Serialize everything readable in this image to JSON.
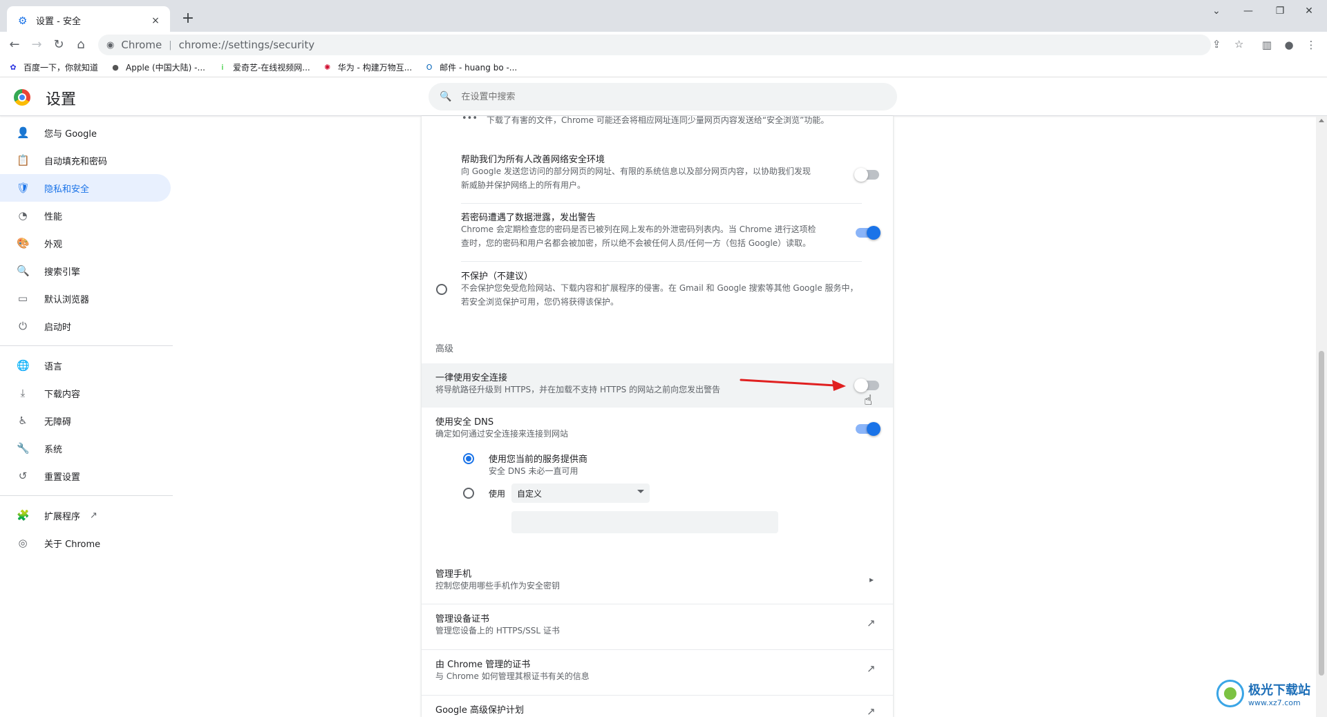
{
  "tab": {
    "title": "设置 - 安全",
    "favicon": "gear-icon",
    "close": "×"
  },
  "new_tab": "+",
  "window": {
    "minimize": "—",
    "restore": "❐",
    "close": "✕",
    "dropdown": "⌄"
  },
  "toolbar": {
    "site_name": "Chrome",
    "url": "chrome://settings/security"
  },
  "bookmarks": [
    {
      "label": "百度一下，你就知道",
      "icon": "baidu-icon",
      "color": "#2932e1",
      "glyph": "✿"
    },
    {
      "label": "Apple (中国大陆) -...",
      "icon": "apple-icon",
      "color": "#555555",
      "glyph": "●"
    },
    {
      "label": "爱奇艺-在线视频网...",
      "icon": "iqiyi-icon",
      "color": "#00be06",
      "glyph": "i"
    },
    {
      "label": "华为 - 构建万物互...",
      "icon": "huawei-icon",
      "color": "#cf0a2c",
      "glyph": "✺"
    },
    {
      "label": "邮件 - huang bo -...",
      "icon": "outlook-icon",
      "color": "#0364b8",
      "glyph": "O"
    }
  ],
  "header": {
    "title": "设置",
    "search_placeholder": "在设置中搜索"
  },
  "sidebar": {
    "items": [
      {
        "label": "您与 Google",
        "icon": "person-icon",
        "glyph": "👤"
      },
      {
        "label": "自动填充和密码",
        "icon": "clipboard-icon",
        "glyph": "📋"
      },
      {
        "label": "隐私和安全",
        "icon": "shield-icon",
        "glyph": "🛡"
      },
      {
        "label": "性能",
        "icon": "speedometer-icon",
        "glyph": "◔"
      },
      {
        "label": "外观",
        "icon": "palette-icon",
        "glyph": "🎨"
      },
      {
        "label": "搜索引擎",
        "icon": "search-icon",
        "glyph": "🔍"
      },
      {
        "label": "默认浏览器",
        "icon": "browser-icon",
        "glyph": "▭"
      },
      {
        "label": "启动时",
        "icon": "power-icon",
        "glyph": "⏻"
      },
      {
        "label": "语言",
        "icon": "globe-icon",
        "glyph": "🌐"
      },
      {
        "label": "下载内容",
        "icon": "download-icon",
        "glyph": "⤓"
      },
      {
        "label": "无障碍",
        "icon": "accessibility-icon",
        "glyph": "♿"
      },
      {
        "label": "系统",
        "icon": "wrench-icon",
        "glyph": "🔧"
      },
      {
        "label": "重置设置",
        "icon": "history-icon",
        "glyph": "↺"
      },
      {
        "label": "扩展程序",
        "icon": "puzzle-icon",
        "glyph": "🧩"
      },
      {
        "label": "关于 Chrome",
        "icon": "chrome-icon",
        "glyph": "◎"
      }
    ],
    "external_link_glyph": "↗"
  },
  "main": {
    "top_desc": "下载了有害的文件，Chrome 可能还会将相应网址连同少量网页内容发送给“安全浏览”功能。",
    "improve": {
      "title": "帮助我们为所有人改善网络安全环境",
      "desc1": "向 Google 发送您访问的部分网页的网址、有限的系统信息以及部分网页内容，以协助我们发现",
      "desc2": "新威胁并保护网络上的所有用户。",
      "enabled": false
    },
    "password_leak": {
      "title": "若密码遭遇了数据泄露，发出警告",
      "desc1": "Chrome 会定期检查您的密码是否已被列在网上发布的外泄密码列表内。当 Chrome 进行这项检",
      "desc2": "查时，您的密码和用户名都会被加密，所以绝不会被任何人员/任何一方（包括 Google）读取。",
      "enabled": true
    },
    "no_protection": {
      "title": "不保护（不建议）",
      "desc1": "不会保护您免受危险网站、下载内容和扩展程序的侵害。在 Gmail 和 Google 搜索等其他 Google 服务中，",
      "desc2": "若安全浏览保护可用，您仍将获得该保护。",
      "selected": false
    },
    "advanced_heading": "高级",
    "https": {
      "title": "一律使用安全连接",
      "desc": "将导航路径升级到 HTTPS，并在加载不支持 HTTPS 的网站之前向您发出警告",
      "enabled": false
    },
    "secure_dns": {
      "title": "使用安全 DNS",
      "desc": "确定如何通过安全连接来连接到网站",
      "enabled": true,
      "option_current": "使用您当前的服务提供商",
      "option_current_desc": "安全 DNS 未必一直可用",
      "option_custom": "使用",
      "custom_select": "自定义"
    },
    "manage_phones": {
      "title": "管理手机",
      "desc": "控制您使用哪些手机作为安全密钥"
    },
    "manage_certs": {
      "title": "管理设备证书",
      "desc": "管理您设备上的 HTTPS/SSL 证书"
    },
    "chrome_certs": {
      "title": "由 Chrome 管理的证书",
      "desc": "与 Chrome 如何管理其根证书有关的信息"
    },
    "advanced_protection": {
      "title": "Google 高级保护计划"
    }
  },
  "watermark": {
    "name": "极光下载站",
    "url": "www.xz7.com"
  },
  "colors": {
    "accent": "#1a73e8",
    "annotation_arrow": "#e02020"
  }
}
